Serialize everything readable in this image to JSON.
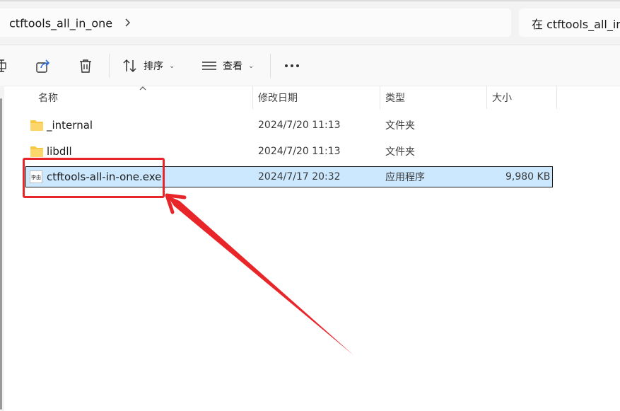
{
  "address": {
    "folder": "ctftools_all_in_one"
  },
  "search": {
    "placeholder": "在 ctftools_all_in_one 中搜索"
  },
  "toolbar": {
    "sort_label": "排序",
    "view_label": "查看"
  },
  "columns": {
    "name": "名称",
    "modified": "修改日期",
    "type": "类型",
    "size": "大小"
  },
  "files": [
    {
      "name": "_internal",
      "modified": "2024/7/20 11:13",
      "type": "文件夹",
      "size": "",
      "icon": "folder-icon"
    },
    {
      "name": "libdll",
      "modified": "2024/7/20 11:13",
      "type": "文件夹",
      "size": "",
      "icon": "folder-icon"
    },
    {
      "name": "ctftools-all-in-one.exe",
      "modified": "2024/7/17 20:32",
      "type": "应用程序",
      "size": "9,980 KB",
      "icon": "exe-icon",
      "icon_text": "李由",
      "selected": true
    }
  ],
  "colors": {
    "selection": "#cce8ff",
    "annotation": "#e8262a",
    "folder": "#f8c843"
  }
}
